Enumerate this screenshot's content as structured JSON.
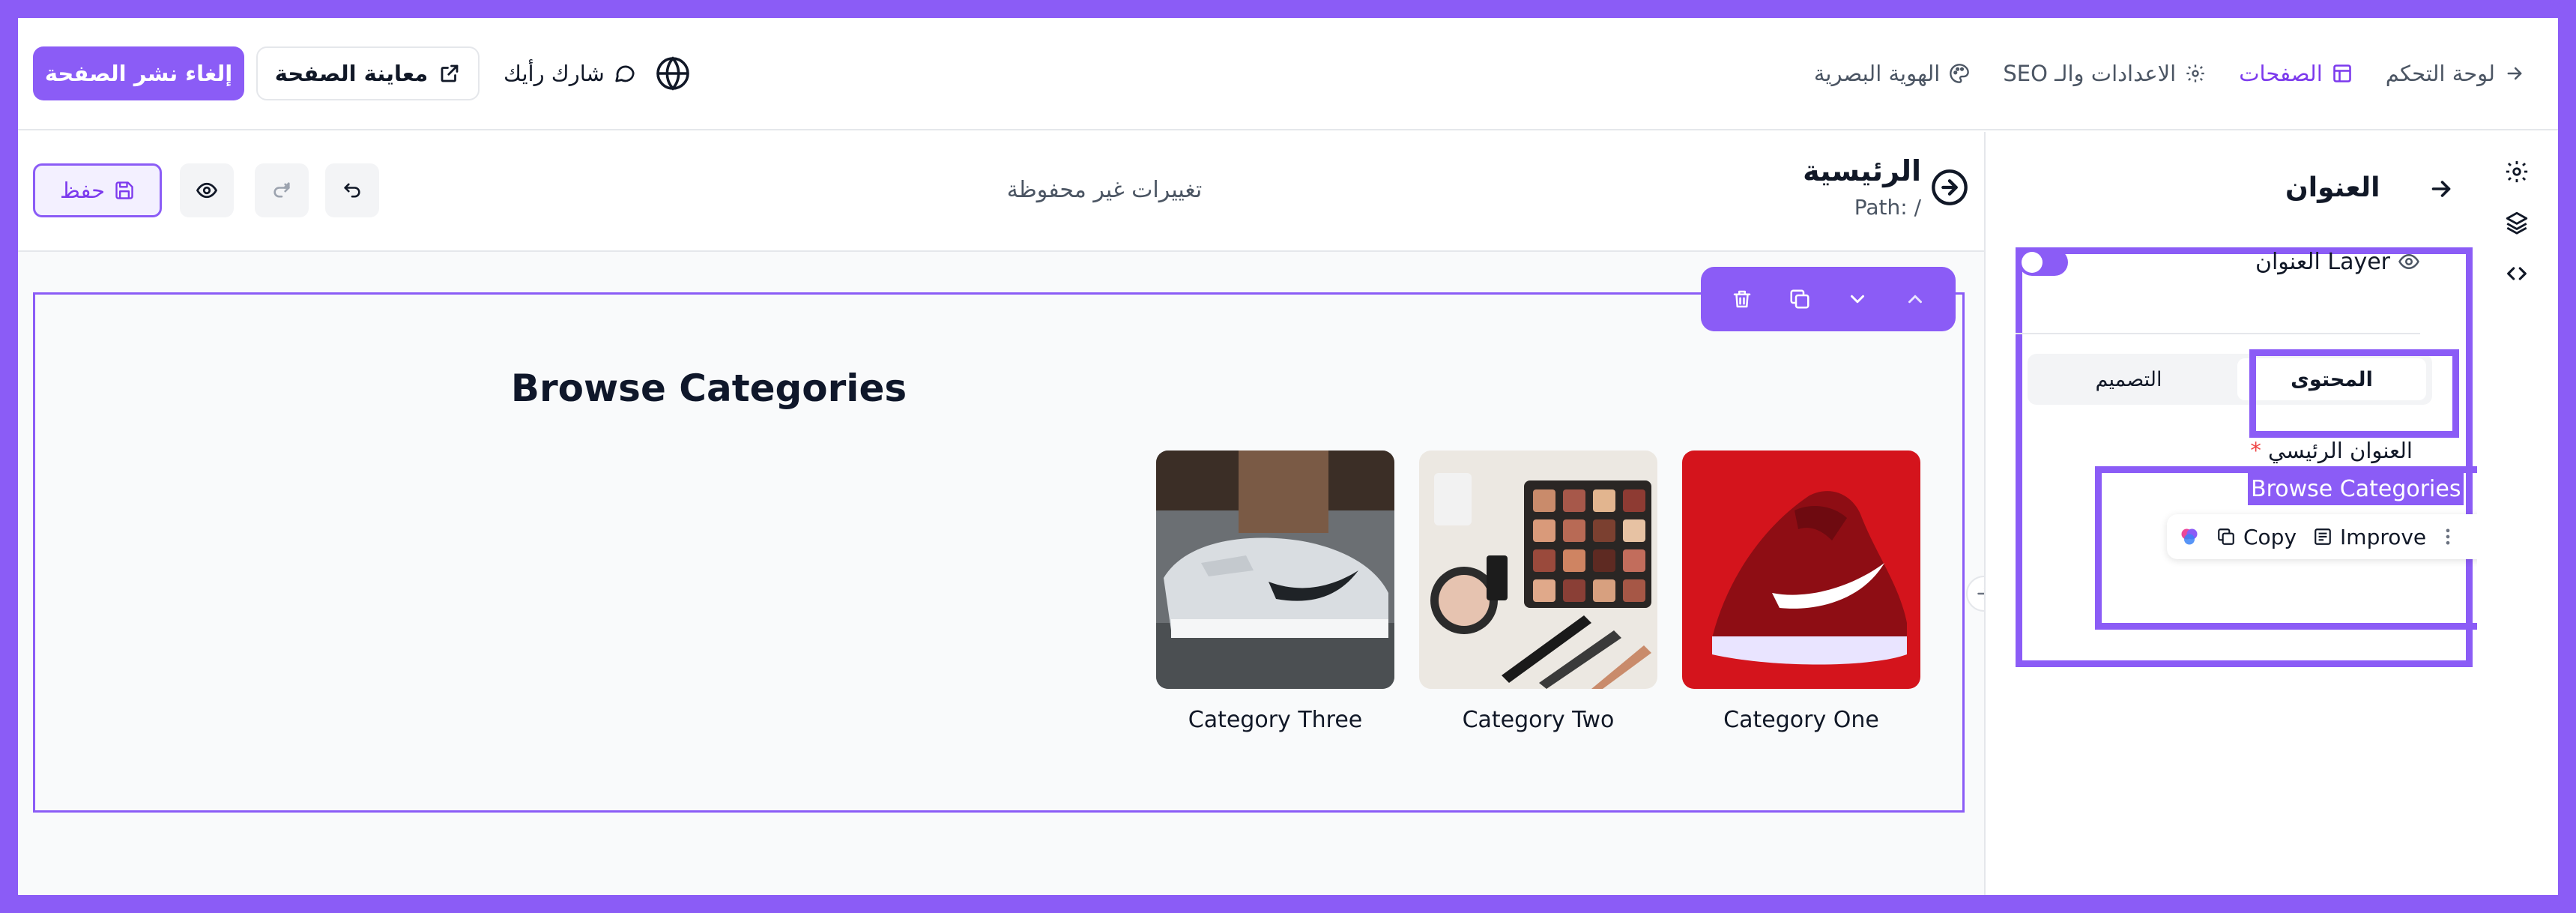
{
  "topbar": {
    "unpublish_label": "إلغاء نشر الصفحة",
    "preview_label": "معاينة الصفحة",
    "share_label": "شارك رأيك",
    "nav": [
      {
        "label": "لوحة التحكم",
        "icon": "arrow-right-icon"
      },
      {
        "label": "الصفحات",
        "icon": "layout-icon",
        "active": true
      },
      {
        "label": "الاعدادات والـ SEO",
        "icon": "gear-icon"
      },
      {
        "label": "الهوية البصرية",
        "icon": "palette-icon"
      }
    ]
  },
  "editor": {
    "save_label": "حفظ",
    "unsaved_text": "تغييرات غير محفوظة",
    "page_name": "الرئيسية",
    "page_path": "Path: /"
  },
  "canvas": {
    "section_title": "Browse Categories",
    "cards": [
      {
        "label": "Category One",
        "image": "red-sneaker"
      },
      {
        "label": "Category Two",
        "image": "makeup-palette"
      },
      {
        "label": "Category Three",
        "image": "white-sneaker"
      }
    ]
  },
  "panel": {
    "title": "العنوان",
    "layer_label": "العنوان Layer",
    "tab_content": "المحتوى",
    "tab_design": "التصميم",
    "field_label": "العنوان الرئيسي",
    "field_value": "Browse Categories",
    "ai_copy": "Copy",
    "ai_improve": "Improve"
  },
  "colors": {
    "accent": "#8b5cf6",
    "accent_dark": "#7c3aed"
  }
}
